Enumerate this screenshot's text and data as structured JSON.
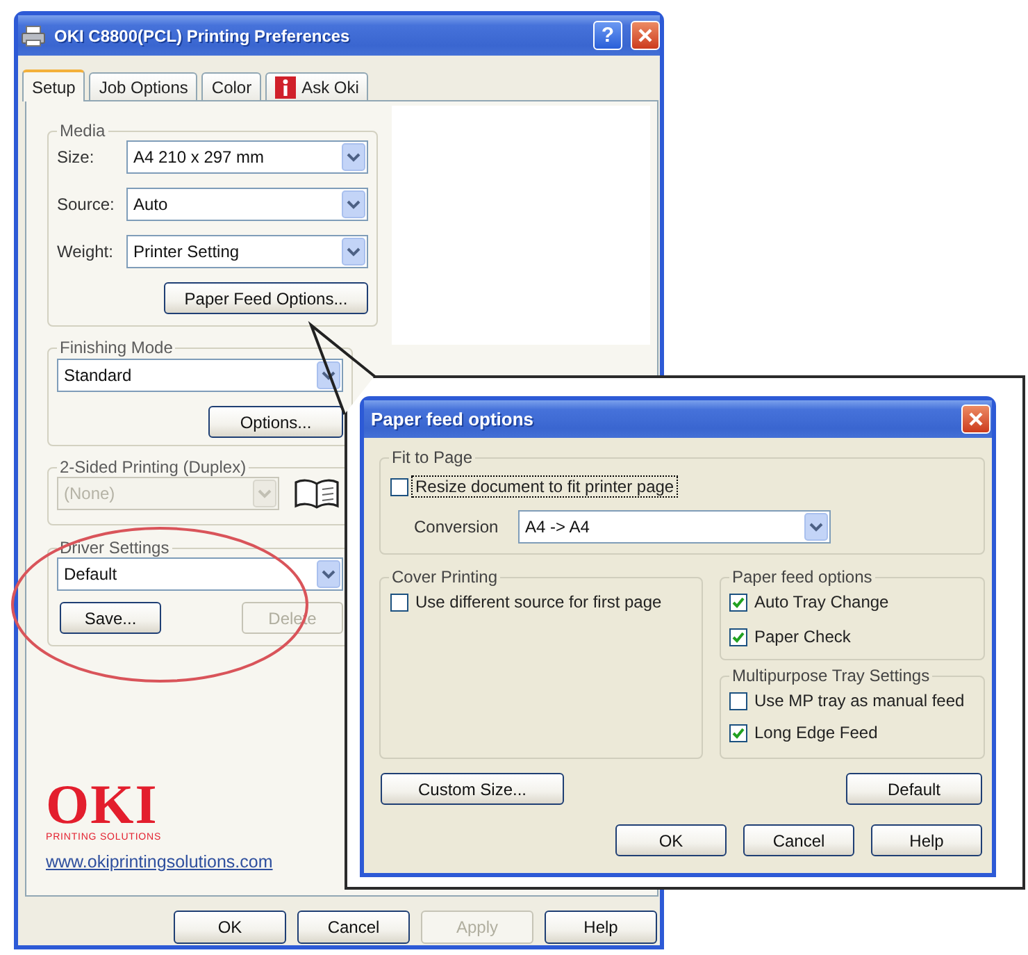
{
  "window": {
    "title": "OKI C8800(PCL) Printing Preferences",
    "help_button": "?"
  },
  "tabs": [
    {
      "label": "Setup",
      "selected": true,
      "kind": "plain"
    },
    {
      "label": "Job Options",
      "selected": false,
      "kind": "plain"
    },
    {
      "label": "Color",
      "selected": false,
      "kind": "plain"
    },
    {
      "label": "Ask Oki",
      "selected": false,
      "kind": "info"
    }
  ],
  "media": {
    "title": "Media",
    "fields": [
      {
        "label": "Size:",
        "value": "A4 210 x 297 mm"
      },
      {
        "label": "Source:",
        "value": "Auto"
      },
      {
        "label": "Weight:",
        "value": "Printer Setting"
      }
    ],
    "button": "Paper Feed Options..."
  },
  "finishing_mode": {
    "title": "Finishing Mode",
    "value": "Standard",
    "button": "Options..."
  },
  "duplex": {
    "title": "2-Sided Printing (Duplex)",
    "value": "(None)",
    "disabled": true
  },
  "driver_settings": {
    "title": "Driver Settings",
    "value": "Default",
    "highlighted": true,
    "buttons": [
      {
        "label": "Save...",
        "disabled": false
      },
      {
        "label": "Delete",
        "disabled": true
      }
    ]
  },
  "logo": {
    "brand": "OKI",
    "tagline": "PRINTING SOLUTIONS",
    "link": "www.okiprintingsolutions.com"
  },
  "buttons": [
    {
      "label": "OK",
      "disabled": false
    },
    {
      "label": "Cancel",
      "disabled": false
    },
    {
      "label": "Apply",
      "disabled": true
    },
    {
      "label": "Help",
      "disabled": false
    }
  ],
  "paper_feed_dialog": {
    "title": "Paper feed options",
    "fit_to_page": {
      "title": "Fit to Page",
      "checkbox": {
        "label": "Resize document to fit printer page",
        "checked": false,
        "focused": true
      },
      "conversion": {
        "label": "Conversion",
        "value": "A4 -> A4"
      }
    },
    "cover_printing": {
      "title": "Cover Printing",
      "options": [
        {
          "label": "Use different source for first page",
          "checked": false
        }
      ]
    },
    "paper_feed_options": {
      "title": "Paper feed options",
      "options": [
        {
          "label": "Auto Tray Change",
          "checked": true
        },
        {
          "label": "Paper Check",
          "checked": true
        }
      ]
    },
    "multipurpose_tray": {
      "title": "Multipurpose Tray Settings",
      "options": [
        {
          "label": "Use MP tray as manual feed",
          "checked": false
        },
        {
          "label": "Long Edge Feed",
          "checked": true
        }
      ]
    },
    "side_buttons": [
      "Custom Size...",
      "Default"
    ],
    "buttons": [
      "OK",
      "Cancel",
      "Help"
    ]
  }
}
